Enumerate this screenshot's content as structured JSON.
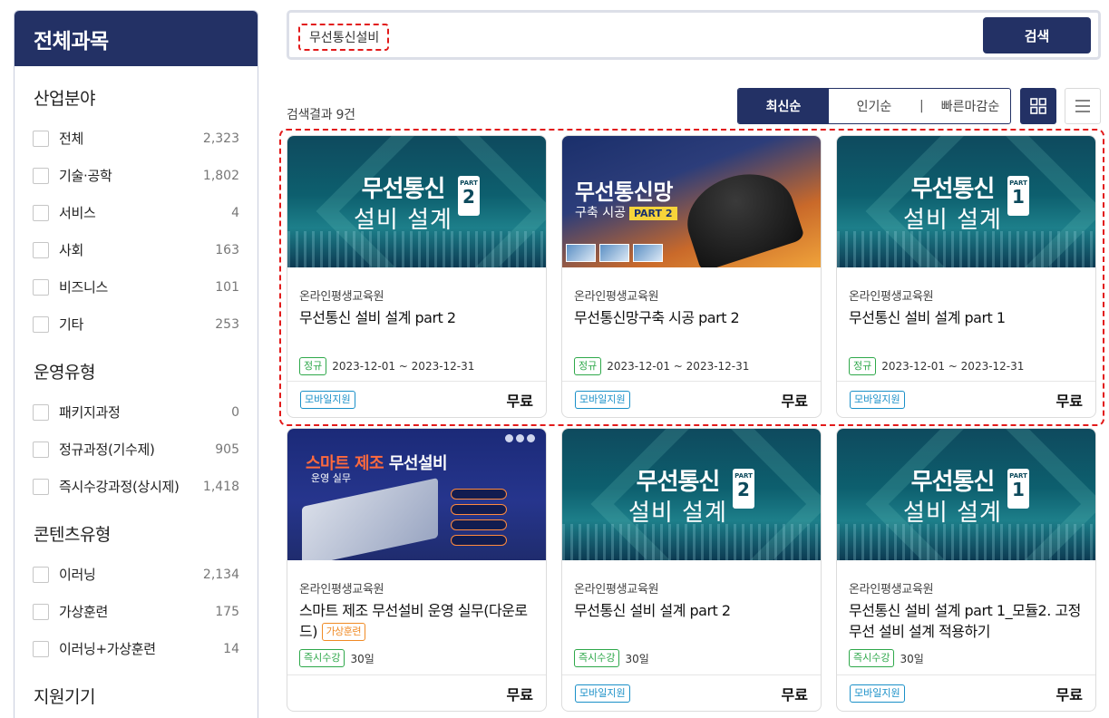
{
  "sidebar": {
    "title": "전체과목",
    "sections": [
      {
        "title": "산업분야",
        "items": [
          {
            "label": "전체",
            "count": "2,323"
          },
          {
            "label": "기술·공학",
            "count": "1,802"
          },
          {
            "label": "서비스",
            "count": "4"
          },
          {
            "label": "사회",
            "count": "163"
          },
          {
            "label": "비즈니스",
            "count": "101"
          },
          {
            "label": "기타",
            "count": "253"
          }
        ]
      },
      {
        "title": "운영유형",
        "items": [
          {
            "label": "패키지과정",
            "count": "0"
          },
          {
            "label": "정규과정(기수제)",
            "count": "905"
          },
          {
            "label": "즉시수강과정(상시제)",
            "count": "1,418"
          }
        ]
      },
      {
        "title": "콘텐츠유형",
        "items": [
          {
            "label": "이러닝",
            "count": "2,134"
          },
          {
            "label": "가상훈련",
            "count": "175"
          },
          {
            "label": "이러닝+가상훈련",
            "count": "14"
          }
        ]
      },
      {
        "title": "지원기기",
        "items": []
      }
    ]
  },
  "search": {
    "value": "무선통신설비",
    "button": "검색"
  },
  "results": {
    "count_text": "검색결과 9건"
  },
  "sort": {
    "latest": "최신순",
    "popular": "인기순",
    "deadline": "빠른마감순",
    "separator": "|"
  },
  "cards": [
    {
      "thumb": {
        "line1": "무선통신",
        "line2": "설비 설계",
        "part_label": "PART",
        "part_num": "2"
      },
      "org": "온라인평생교육원",
      "title": "무선통신 설비 설계 part 2",
      "tag": "정규",
      "period": "2023-12-01 ~ 2023-12-31",
      "device": "모바일지원",
      "price": "무료"
    },
    {
      "thumb": {
        "line1": "무선통신망",
        "line2": "구축 시공",
        "part_label": "PART 2"
      },
      "org": "온라인평생교육원",
      "title": "무선통신망구축 시공 part 2",
      "tag": "정규",
      "period": "2023-12-01 ~ 2023-12-31",
      "device": "모바일지원",
      "price": "무료"
    },
    {
      "thumb": {
        "line1": "무선통신",
        "line2": "설비 설계",
        "part_label": "PART",
        "part_num": "1"
      },
      "org": "온라인평생교육원",
      "title": "무선통신 설비 설계 part 1",
      "tag": "정규",
      "period": "2023-12-01 ~ 2023-12-31",
      "device": "모바일지원",
      "price": "무료"
    },
    {
      "thumb": {
        "line1a": "스마트 제조 ",
        "line1b": "무선설비",
        "line2": "운영 실무"
      },
      "org": "온라인평생교육원",
      "title": "스마트 제조 무선설비 운영 실무(다운로드)",
      "title_tag": "가상훈련",
      "tag": "즉시수강",
      "period": "30일",
      "device": "",
      "price": "무료"
    },
    {
      "thumb": {
        "line1": "무선통신",
        "line2": "설비 설계",
        "part_label": "PART",
        "part_num": "2"
      },
      "org": "온라인평생교육원",
      "title": "무선통신 설비 설계 part 2",
      "tag": "즉시수강",
      "period": "30일",
      "device": "모바일지원",
      "price": "무료"
    },
    {
      "thumb": {
        "line1": "무선통신",
        "line2": "설비 설계",
        "part_label": "PART",
        "part_num": "1"
      },
      "org": "온라인평생교육원",
      "title": "무선통신 설비 설계 part 1_모듈2. 고정 무선 설비 설계 적용하기",
      "tag": "즉시수강",
      "period": "30일",
      "device": "모바일지원",
      "price": "무료"
    }
  ],
  "colors": {
    "primary": "#233165",
    "highlight": "#e21a1a",
    "tag_green": "#2ea84a",
    "tag_orange": "#f08a24",
    "tag_blue": "#1a90c8"
  },
  "icons": {
    "grid_view": "grid-icon",
    "list_view": "list-icon"
  }
}
